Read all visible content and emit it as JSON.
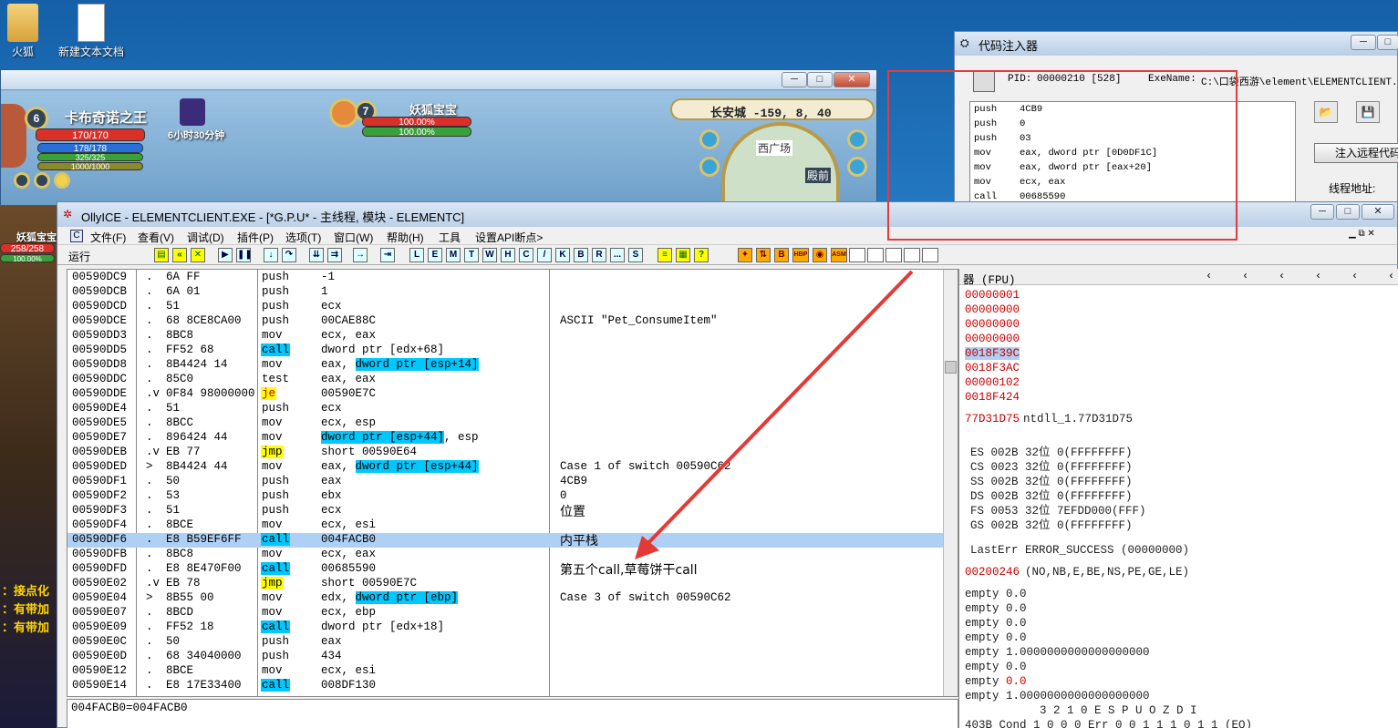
{
  "desktop": {
    "icons": [
      {
        "label": "火狐"
      },
      {
        "label": "新建文本文档"
      }
    ]
  },
  "game": {
    "player_name": "卡布奇诺之王",
    "level": "6",
    "hp": "170/170",
    "mp": "178/178",
    "bar3": "325/325",
    "bar4": "1000/1000",
    "buff_time": "6小时30分钟",
    "pet_name": "妖狐宝宝",
    "pet_level": "7",
    "pet_hp": "100.00%",
    "pet_mp": "100.00%",
    "location": "长安城 -159, 8, 40",
    "map_label": "西广场",
    "map_label2": "殿前",
    "left_name": "妖狐宝宝",
    "left_hp": "258/258",
    "left_pct": "100.00%",
    "chat_lines": [
      "：接点化",
      "：有带加",
      "：有带加"
    ]
  },
  "injector": {
    "title": "代码注入器",
    "pid_label": "PID:",
    "pid_value": "00000210 [528]",
    "exe_label": "ExeName:",
    "exe_value": "C:\\口袋西游\\element\\ELEMENTCLIENT.EX",
    "code": [
      {
        "op": "push",
        "arg": "4CB9"
      },
      {
        "op": "push",
        "arg": "0"
      },
      {
        "op": "push",
        "arg": "03"
      },
      {
        "op": "mov",
        "arg": "eax, dword ptr [0D0DF1C]"
      },
      {
        "op": "mov",
        "arg": "eax, dword ptr [eax+20]"
      },
      {
        "op": "mov",
        "arg": "ecx, eax"
      },
      {
        "op": "call",
        "arg": "00685590"
      }
    ],
    "inject_button": "注入远程代码",
    "thread_label": "线程地址:"
  },
  "olly": {
    "title": "OllyICE - ELEMENTCLIENT.EXE - [*G.P.U* - 主线程, 模块 - ELEMENTC]",
    "menus": [
      "文件(F)",
      "查看(V)",
      "调试(D)",
      "插件(P)",
      "选项(T)",
      "窗口(W)",
      "帮助(H)",
      "工具",
      "设置API断点>"
    ],
    "run_label": "运行",
    "toolbar_letters": [
      "L",
      "E",
      "M",
      "T",
      "W",
      "H",
      "C",
      "/",
      "K",
      "B",
      "R",
      "...",
      "S"
    ],
    "rows": [
      {
        "addr": "00590DC9",
        "mk": ".",
        "hex": "6A FF",
        "op": "push",
        "arg": "-1",
        "cm": ""
      },
      {
        "addr": "00590DCB",
        "mk": ".",
        "hex": "6A 01",
        "op": "push",
        "arg": "1",
        "cm": ""
      },
      {
        "addr": "00590DCD",
        "mk": ".",
        "hex": "51",
        "op": "push",
        "arg": "ecx",
        "cm": ""
      },
      {
        "addr": "00590DCE",
        "mk": ".",
        "hex": "68 8CE8CA00",
        "op": "push",
        "arg": "00CAE88C",
        "cm": "ASCII \"Pet_ConsumeItem\""
      },
      {
        "addr": "00590DD3",
        "mk": ".",
        "hex": "8BC8",
        "op": "mov",
        "arg": "ecx, eax",
        "cm": ""
      },
      {
        "addr": "00590DD5",
        "mk": ".",
        "hex": "FF52 68",
        "op": "call",
        "arg": "dword ptr [edx+68]",
        "cm": ""
      },
      {
        "addr": "00590DD8",
        "mk": ".",
        "hex": "8B4424 14",
        "op": "mov",
        "arg": "eax, ",
        "hlarg": "dword ptr [esp+14]",
        "cm": ""
      },
      {
        "addr": "00590DDC",
        "mk": ".",
        "hex": "85C0",
        "op": "test",
        "arg": "eax, eax",
        "cm": ""
      },
      {
        "addr": "00590DDE",
        "mk": ".v",
        "hex": "0F84 98000000",
        "op": "je",
        "arg": "00590E7C",
        "cm": ""
      },
      {
        "addr": "00590DE4",
        "mk": ".",
        "hex": "51",
        "op": "push",
        "arg": "ecx",
        "cm": ""
      },
      {
        "addr": "00590DE5",
        "mk": ".",
        "hex": "8BCC",
        "op": "mov",
        "arg": "ecx, esp",
        "cm": ""
      },
      {
        "addr": "00590DE7",
        "mk": ".",
        "hex": "896424 44",
        "op": "mov",
        "arg": "",
        "hlarg": "dword ptr [esp+44]",
        "arg2": ", esp",
        "cm": ""
      },
      {
        "addr": "00590DEB",
        "mk": ".v",
        "hex": "EB 77",
        "op": "jmp",
        "arg": "short 00590E64",
        "cm": ""
      },
      {
        "addr": "00590DED",
        "mk": ">",
        "hex": "8B4424 44",
        "op": "mov",
        "arg": "eax, ",
        "hlarg": "dword ptr [esp+44]",
        "cm": "Case 1 of switch 00590C62"
      },
      {
        "addr": "00590DF1",
        "mk": ".",
        "hex": "50",
        "op": "push",
        "arg": "eax",
        "cm": "4CB9"
      },
      {
        "addr": "00590DF2",
        "mk": ".",
        "hex": "53",
        "op": "push",
        "arg": "ebx",
        "cm": "0"
      },
      {
        "addr": "00590DF3",
        "mk": ".",
        "hex": "51",
        "op": "push",
        "arg": "ecx",
        "cm": "位置"
      },
      {
        "addr": "00590DF4",
        "mk": ".",
        "hex": "8BCE",
        "op": "mov",
        "arg": "ecx, esi",
        "cm": ""
      },
      {
        "addr": "00590DF6",
        "mk": ".",
        "hex": "E8 B59EF6FF",
        "op": "call",
        "arg": "004FACB0",
        "cm": "内平栈",
        "sel": true
      },
      {
        "addr": "00590DFB",
        "mk": ".",
        "hex": "8BC8",
        "op": "mov",
        "arg": "ecx, eax",
        "cm": ""
      },
      {
        "addr": "00590DFD",
        "mk": ".",
        "hex": "E8 8E470F00",
        "op": "call",
        "arg": "00685590",
        "cm": "第五个call,草莓饼干call"
      },
      {
        "addr": "00590E02",
        "mk": ".v",
        "hex": "EB 78",
        "op": "jmp",
        "arg": "short 00590E7C",
        "cm": ""
      },
      {
        "addr": "00590E04",
        "mk": ">",
        "hex": "8B55 00",
        "op": "mov",
        "arg": "edx, ",
        "hlarg": "dword ptr [ebp]",
        "cm": "Case 3 of switch 00590C62"
      },
      {
        "addr": "00590E07",
        "mk": ".",
        "hex": "8BCD",
        "op": "mov",
        "arg": "ecx, ebp",
        "cm": ""
      },
      {
        "addr": "00590E09",
        "mk": ".",
        "hex": "FF52 18",
        "op": "call",
        "arg": "dword ptr [edx+18]",
        "cm": ""
      },
      {
        "addr": "00590E0C",
        "mk": ".",
        "hex": "50",
        "op": "push",
        "arg": "eax",
        "cm": ""
      },
      {
        "addr": "00590E0D",
        "mk": ".",
        "hex": "68 34040000",
        "op": "push",
        "arg": "434",
        "cm": ""
      },
      {
        "addr": "00590E12",
        "mk": ".",
        "hex": "8BCE",
        "op": "mov",
        "arg": "ecx, esi",
        "cm": ""
      },
      {
        "addr": "00590E14",
        "mk": ".",
        "hex": "E8 17E33400",
        "op": "call",
        "arg": "008DF130",
        "cm": ""
      }
    ],
    "status_text": "004FACB0=004FACB0",
    "regs_header": "器 (FPU)",
    "stack_values": [
      "00000001",
      "00000000",
      "00000000",
      "00000000",
      "0018F39C",
      "0018F3AC",
      "00000102",
      "0018F424"
    ],
    "stack_highlight_index": 4,
    "eip_line": [
      "77D31D75",
      " ntdll_1.77D31D75"
    ],
    "segs": [
      "ES 002B 32位 0(FFFFFFFF)",
      "CS 0023 32位 0(FFFFFFFF)",
      "SS 002B 32位 0(FFFFFFFF)",
      "DS 002B 32位 0(FFFFFFFF)",
      "FS 0053 32位 7EFDD000(FFF)",
      "GS 002B 32位 0(FFFFFFFF)"
    ],
    "lasterr": "LastErr ERROR_SUCCESS (00000000)",
    "eflags": [
      "00200246",
      " (NO,NB,E,BE,NS,PE,GE,LE)"
    ],
    "fpu": [
      "empty 0.0",
      "empty 0.0",
      "empty 0.0",
      "empty 0.0",
      "empty 1.0000000000000000000",
      "empty 0.0",
      "empty 0.0",
      "empty 1.0000000000000000000"
    ],
    "fpu_red_index": 6,
    "fpu_bits": "3 2 1 0      E S P U O Z D I",
    "fpu_cond": "403B  Cond 1 0 0 0  Err 0 0 1 1 1 0 1 1  (EQ)"
  },
  "colors": {
    "call": "#00c8ff",
    "jmp": "#ffff00",
    "redbox": "#e33a3a",
    "arrow": "#e53935"
  }
}
